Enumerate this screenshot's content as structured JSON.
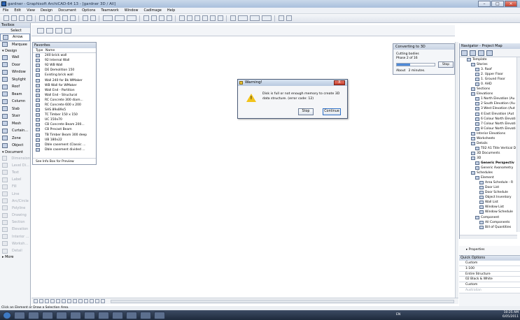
{
  "window": {
    "title": "gardner - Graphisoft ArchiCAD-64 13 - [gardner 3D / All]"
  },
  "menu": [
    "File",
    "Edit",
    "View",
    "Design",
    "Document",
    "Options",
    "Teamwork",
    "Window",
    "CadImage",
    "Help"
  ],
  "toolbox": {
    "title": "Toolbox",
    "select_label": "Select",
    "arrow_label": "Arrow",
    "marquee_label": "Marquee",
    "design_group": "Design",
    "design_tools": [
      "Wall",
      "Door",
      "Window",
      "Skylight",
      "Roof",
      "Beam",
      "Column",
      "Slab",
      "Stair",
      "Mesh",
      "Curtain...",
      "Zone",
      "Object"
    ],
    "document_group": "Document",
    "document_tools": [
      "Dimension",
      "Level Di...",
      "Text",
      "Label",
      "Fill",
      "Line",
      "Arc/Circle",
      "Polyline",
      "Drawing",
      "Section",
      "Elevation",
      "Interior ...",
      "Worksh...",
      "Detail"
    ],
    "more_label": "More"
  },
  "favorites": {
    "title": "Favorites",
    "col_type": "Type",
    "col_name": "Name",
    "items": [
      "240 brick wall",
      "92 Internal Wall",
      "92 WB Wall",
      "DE Demolition 150",
      "Existing brick wall",
      "Wall 240 for Bk WMaker",
      "WB Wall for WMaker",
      "Wall End - Partition",
      "Wall End - Structural",
      "RC Concrete 300 diam...",
      "RC Concrete 600 x 200",
      "SHS 89x89x5",
      "TC Timber 150 x 150",
      "UC 150x70",
      "CB Concrete Beam 200...",
      "CB Precast Beam",
      "TB Timber Beam 300 deep",
      "UB 180x22",
      "Dble casement (Classic ...",
      "Dble casement divided ..."
    ],
    "footer": "See Info Box for Preview"
  },
  "converting": {
    "title": "Converting to 3D",
    "line1": "Cutting bodies",
    "line2": "Phase 2 of 16",
    "progress": 0.35,
    "stop_label": "Stop",
    "about_label": "About",
    "about_value": "2 minutes."
  },
  "warning": {
    "title": "Warning!",
    "close_label": "X",
    "message": "Disk is full or not enough memory to create 3D data structure. (error code: 12)",
    "stop_label": "Stop",
    "continue_label": "Continue"
  },
  "navigator": {
    "title": "Navigator - Project Map",
    "tree": [
      {
        "label": "Template",
        "level": 0
      },
      {
        "label": "Stories",
        "level": 1
      },
      {
        "label": "3. Roof",
        "level": 2
      },
      {
        "label": "2. Upper Floor",
        "level": 2
      },
      {
        "label": "1. Ground Floor",
        "level": 2
      },
      {
        "label": "0. AHD",
        "level": 2
      },
      {
        "label": "Sections",
        "level": 1
      },
      {
        "label": "Elevations",
        "level": 1
      },
      {
        "label": "1 North Elevation (Au",
        "level": 2
      },
      {
        "label": "2 South Elevation (Au",
        "level": 2
      },
      {
        "label": "3 West Elevation (Aut",
        "level": 2
      },
      {
        "label": "4 East Elevation (Aut",
        "level": 2
      },
      {
        "label": "6 Colour North Elevati",
        "level": 2
      },
      {
        "label": "7 Colour North Elevati",
        "level": 2
      },
      {
        "label": "8 Colour North Elevati",
        "level": 2
      },
      {
        "label": "Interior Elevations",
        "level": 1
      },
      {
        "label": "Worksheets",
        "level": 1
      },
      {
        "label": "Details",
        "level": 1
      },
      {
        "label": "T02 A1 Title Vertical D",
        "level": 2
      },
      {
        "label": "3D Documents",
        "level": 1
      },
      {
        "label": "3D",
        "level": 1
      },
      {
        "label": "Generic Perspectiv",
        "level": 2,
        "hl": true
      },
      {
        "label": "Generic Axonometry",
        "level": 2
      },
      {
        "label": "Schedules",
        "level": 1
      },
      {
        "label": "Element",
        "level": 2
      },
      {
        "label": "Area Schedule - R",
        "level": 3
      },
      {
        "label": "Door List",
        "level": 3
      },
      {
        "label": "Door Schedule",
        "level": 3
      },
      {
        "label": "Object Inventory",
        "level": 3
      },
      {
        "label": "Wall List",
        "level": 3
      },
      {
        "label": "Window List",
        "level": 3
      },
      {
        "label": "Window Schedule",
        "level": 3
      },
      {
        "label": "Component",
        "level": 2
      },
      {
        "label": "All Components",
        "level": 3
      },
      {
        "label": "Bill of Quantities",
        "level": 3
      }
    ]
  },
  "properties_label": "Properties",
  "quick_options": {
    "title": "Quick Options",
    "rows": [
      "Custom",
      "1:100",
      "Entire Structure",
      "02 Black & White",
      "Custom",
      "Australian"
    ]
  },
  "status": {
    "text": "Click an Element or Draw a Selection Area."
  },
  "taskbar": {
    "lang": "EN",
    "time": "10:25 AM",
    "date": "6/05/2011"
  },
  "accent": "#2c63b4",
  "warning_color": "#f2c31a"
}
